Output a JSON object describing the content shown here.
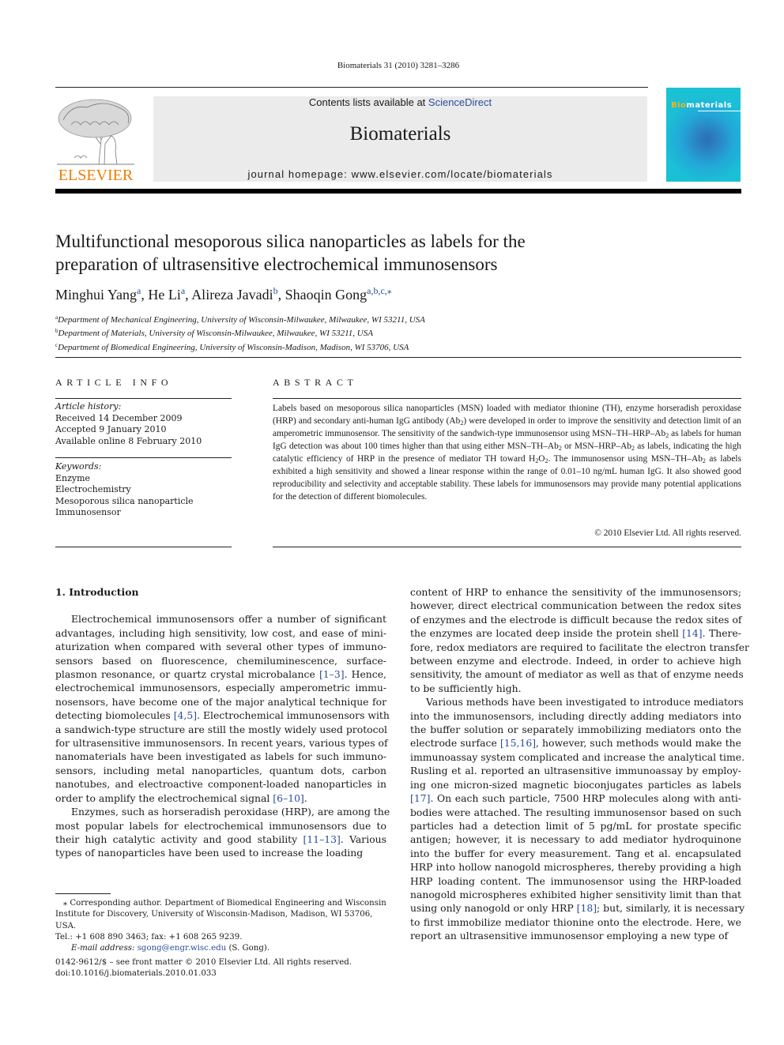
{
  "running_head": "Biomaterials 31 (2010) 3281–3286",
  "publisher": {
    "logo_word": "ELSEVIER",
    "logo_color": "#f07d00"
  },
  "journal_box": {
    "contents_prefix": "Contents lists available at ",
    "contents_link": "ScienceDirect",
    "journal_title": "Biomaterials",
    "homepage": "journal homepage: www.elsevier.com/locate/biomaterials"
  },
  "cover": {
    "title_highlight": "Bio",
    "title_rest": "materials"
  },
  "article": {
    "title_line1": "Multifunctional mesoporous silica nanoparticles as labels for the",
    "title_line2": "preparation of ultrasensitive electrochemical immunosensors",
    "authors": [
      {
        "name": "Minghui Yang",
        "sup": "a"
      },
      {
        "name": "He Li",
        "sup": "a"
      },
      {
        "name": "Alireza Javadi",
        "sup": "b"
      },
      {
        "name": "Shaoqin Gong",
        "sup": "a,b,c,⁎"
      }
    ],
    "affiliations": [
      {
        "key": "a",
        "text": "Department of Mechanical Engineering, University of Wisconsin-Milwaukee, Milwaukee, WI 53211, USA"
      },
      {
        "key": "b",
        "text": "Department of Materials, University of Wisconsin-Milwaukee, Milwaukee, WI 53211, USA"
      },
      {
        "key": "c",
        "text": "Department of Biomedical Engineering, University of Wisconsin-Madison, Madison, WI 53706, USA"
      }
    ]
  },
  "article_info": {
    "heading": "ARTICLE INFO",
    "history_label": "Article history:",
    "history": [
      "Received 14 December 2009",
      "Accepted 9 January 2010",
      "Available online 8 February 2010"
    ],
    "keywords_label": "Keywords:",
    "keywords": [
      "Enzyme",
      "Electrochemistry",
      "Mesoporous silica nanoparticle",
      "Immunosensor"
    ]
  },
  "abstract": {
    "heading": "ABSTRACT",
    "p1": "Labels based on mesoporous silica nanoparticles (MSN) loaded with mediator thionine (TH), enzyme horseradish peroxidase (HRP) and secondary anti-human IgG antibody (Ab",
    "p2": ") were developed in order to improve the sensitivity and detection limit of an amperometric immunosensor. The sensitivity of the sandwich-type immunosensor using MSN–TH–HRP–Ab",
    "p3": " as labels for human IgG detection was about 100 times higher than that using either MSN–TH–Ab",
    "p4": " or MSN–HRP–Ab",
    "p5": " as labels, indicating the high catalytic efficiency of HRP in the presence of mediator TH toward H",
    "p6": "O",
    "p7": ". The immunosensor using MSN–TH–Ab",
    "p8": " as labels exhibited a high sensitivity and showed a linear response within the range of 0.01–10 ng/mL human IgG. It also showed good reproducibility and selectivity and acceptable stability. These labels for immunosensors may provide many potential applications for the detection of different biomolecules.",
    "sub2": "2",
    "copyright": "© 2010 Elsevier Ltd. All rights reserved."
  },
  "body": {
    "section_heading": "1.  Introduction",
    "left_lines": [
      "Electrochemical immunosensors offer a number of significant",
      "advantages, including high sensitivity, low cost, and ease of mini-",
      "aturization when compared with several other types of immuno-",
      "sensors based on fluorescence, chemiluminescence, surface-",
      [
        "plasmon resonance, or quartz crystal microbalance ",
        "[1–3]",
        ". Hence,"
      ],
      "electrochemical immunosensors, especially amperometric immu-",
      "nosensors, have become one of the major analytical technique for",
      [
        "detecting biomolecules ",
        "[4,5]",
        ". Electrochemical immunosensors with"
      ],
      "a sandwich-type structure are still the mostly widely used protocol",
      "for ultrasensitive immunosensors. In recent years, various types of",
      "nanomaterials have been investigated as labels for such immuno-",
      "sensors, including metal nanoparticles, quantum dots, carbon",
      "nanotubes, and electroactive component-loaded nanoparticles in",
      [
        "order to amplify the electrochemical signal ",
        "[6–10]",
        "."
      ],
      "Enzymes, such as horseradish peroxidase (HRP), are among the",
      "most popular labels for electrochemical immunosensors due to",
      [
        "their high catalytic activity and good stability ",
        "[11–13]",
        ". Various"
      ],
      "types of nanoparticles have been used to increase the loading"
    ],
    "right_lines": [
      "content of HRP to enhance the sensitivity of the immunosensors;",
      "however, direct electrical communication between the redox sites",
      "of enzymes and the electrode is difficult because the redox sites of",
      [
        "the enzymes are located deep inside the protein shell ",
        "[14]",
        ". There-"
      ],
      "fore, redox mediators are required to facilitate the electron transfer",
      "between enzyme and electrode. Indeed, in order to achieve high",
      "sensitivity, the amount of mediator as well as that of enzyme needs",
      "to be sufficiently high.",
      "Various methods have been investigated to introduce mediators",
      "into the immunosensors, including directly adding mediators into",
      "the buffer solution or separately immobilizing mediators onto the",
      [
        "electrode surface ",
        "[15,16]",
        ", however, such methods would make the"
      ],
      "immunoassay system complicated and increase the analytical time.",
      "Rusling et al. reported an ultrasensitive immunoassay by employ-",
      "ing one micron-sized magnetic bioconjugates particles as labels",
      [
        "",
        "[17]",
        ". On each such particle, 7500 HRP molecules along with anti-"
      ],
      "bodies were attached. The resulting immunosensor based on such",
      "particles had a detection limit of 5 pg/mL for prostate specific",
      "antigen; however, it is necessary to add mediator hydroquinone",
      "into the buffer for every measurement. Tang et al. encapsulated",
      "HRP into hollow nanogold microspheres, thereby providing a high",
      "HRP loading content. The immunosensor using the HRP-loaded",
      "nanogold microspheres exhibited higher sensitivity limit than that",
      [
        "using only nanogold or only HRP ",
        "[18]",
        "; but, similarly, it is necessary"
      ],
      "to first immobilize mediator thionine onto the electrode. Here, we",
      "report an ultrasensitive immunosensor employing a new type of"
    ]
  },
  "footnote": {
    "line1": "⁎ Corresponding author. Department of Biomedical Engineering and Wisconsin",
    "line2": "Institute for Discovery, University of Wisconsin-Madison, Madison, WI 53706, USA.",
    "line3": "Tel.: +1 608 890 3463; fax: +1 608 265 9239.",
    "email_label": "E-mail address: ",
    "email": "sgong@engr.wisc.edu",
    "email_suffix": " (S. Gong)."
  },
  "front_matter": {
    "issn": "0142-9612/$ – see front matter © 2010 Elsevier Ltd. All rights reserved.",
    "doi": "doi:10.1016/j.biomaterials.2010.01.033"
  },
  "colors": {
    "link": "#2a4d9b",
    "journal_box_bg": "#ebebeb",
    "elsevier_orange": "#f07d00"
  }
}
